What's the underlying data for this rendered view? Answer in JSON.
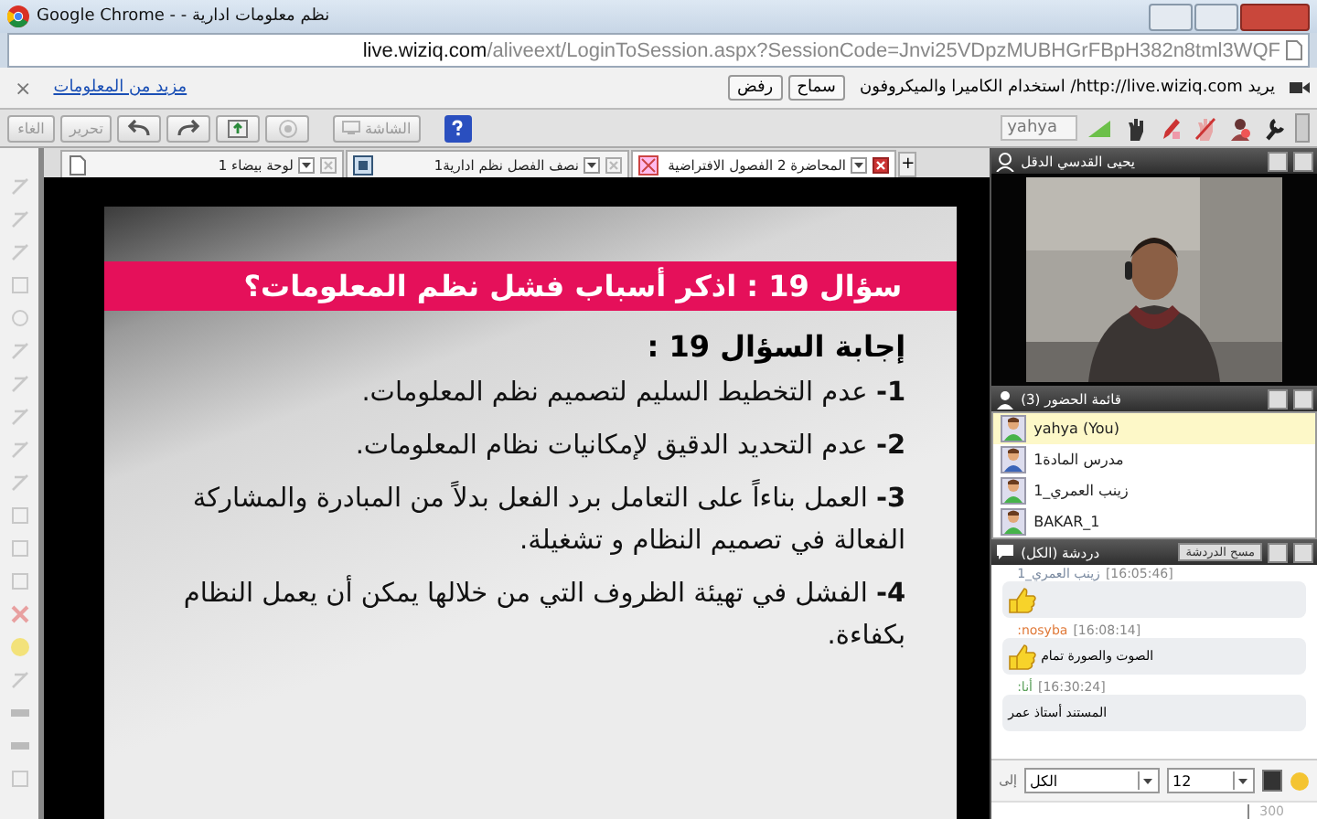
{
  "window": {
    "title": "Google Chrome - - نظم معلومات ادارية"
  },
  "address_bar": {
    "host": "live.wiziq.com",
    "path": "/aliveext/LoginToSession.aspx?SessionCode=Jnvi25VDpzMUBHGrFBpH382n8tml3WQF"
  },
  "infobar": {
    "message": "يريد http://live.wiziq.com/ استخدام الكاميرا والميكروفون",
    "buttons": [
      "سماح",
      "رفض"
    ],
    "link": "مزيد من المعلومات",
    "close": "×"
  },
  "toolbar": {
    "buttons": [
      {
        "kind": "help",
        "disabled": false
      },
      {
        "kind": "screen",
        "label": "الشاشة",
        "disabled": true
      },
      {
        "kind": "record",
        "disabled": true
      },
      {
        "kind": "upload",
        "disabled": false
      },
      {
        "kind": "redo",
        "disabled": false
      },
      {
        "kind": "undo",
        "disabled": false
      },
      {
        "kind": "text",
        "label": "تحرير",
        "disabled": true
      },
      {
        "kind": "text",
        "label": "الغاء",
        "disabled": true
      }
    ],
    "user": "yahya",
    "status_icons": [
      {
        "kind": "signal"
      },
      {
        "kind": "hand"
      },
      {
        "kind": "pen"
      },
      {
        "kind": "hand-off"
      },
      {
        "kind": "mic-off"
      },
      {
        "kind": "settings"
      }
    ]
  },
  "tabs": [
    {
      "label": "المحاضرة 2 الفصول الافتراضية",
      "selected": true,
      "kind": "presentation"
    },
    {
      "label": "نصف الفصل نظم ادارية1",
      "selected": false,
      "kind": "document"
    },
    {
      "label": "لوحة بيضاء 1",
      "selected": false,
      "kind": "whiteboard"
    }
  ],
  "add_tab": "+",
  "slide": {
    "question": "سؤال 19 : اذكر أسباب فشل نظم المعلومات؟",
    "answer_title": "إجابة السؤال 19 :",
    "items": [
      "**1-** عدم التخطيط السليم لتصميم نظم المعلومات.",
      "**2-** عدم التحديد الدقيق لإمكانيات نظام المعلومات.",
      "**3-** العمل بناءاً على التعامل برد الفعل بدلاً من المبادرة والمشاركة الفعالة في تصميم النظام و تشغيلة.",
      "**4-** الفشل في تهيئة الظروف التي من خلالها يمكن أن يعمل النظام بكفاءة."
    ]
  },
  "video": {
    "title": "يحيى القدسي الدقل",
    "kind": "picture"
  },
  "attendees": {
    "title": "قائمة الحضور (3)",
    "people": [
      {
        "name": "yahya (You)",
        "selected": true,
        "kind": "student"
      },
      {
        "name": "مدرس المادة1",
        "selected": false,
        "kind": "teacher"
      },
      {
        "name": "زينب العمري_1",
        "selected": false,
        "kind": "student"
      },
      {
        "name": "BAKAR_1",
        "selected": false,
        "kind": "student"
      }
    ]
  },
  "chat": {
    "title": "دردشة (الكل)",
    "clear_button": "مسح الدردشة",
    "messages": [
      {
        "sender": "زينب العمري_1",
        "color": "#7a8aa0",
        "time": "[16:05:46]",
        "thumbs": true
      },
      {
        "sender": "nosyba:",
        "color": "#e07a3a",
        "time": "[16:08:14]",
        "thumbs": true,
        "text": "الصوت والصورة تمام"
      },
      {
        "sender": "أنا:",
        "color": "#5aa05a",
        "time": "[16:30:24]",
        "thumbs": false,
        "text": "المستند أستاذ عمر"
      }
    ],
    "to_label": "إلى",
    "recipient": "الكل",
    "font_size": "12",
    "counter": "300"
  }
}
